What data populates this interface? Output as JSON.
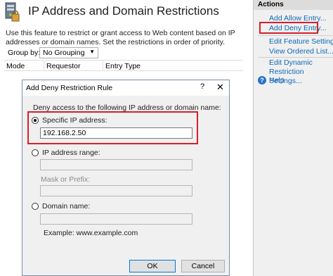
{
  "header": {
    "title": "IP Address and Domain Restrictions",
    "description": "Use this feature to restrict or grant access to Web content based on IP addresses or domain names. Set the restrictions in order of priority."
  },
  "toolbar": {
    "groupby_label": "Group by:",
    "groupby_value": "No Grouping"
  },
  "list": {
    "columns": [
      "Mode",
      "Requestor",
      "Entry Type"
    ]
  },
  "actions": {
    "title": "Actions",
    "items": [
      "Add Allow Entry...",
      "Add Deny Entry...",
      "Edit Feature Settings...",
      "View Ordered List...",
      "Edit Dynamic Restriction Settings...",
      "Help"
    ]
  },
  "dialog": {
    "title": "Add Deny Restriction Rule",
    "help_glyph": "?",
    "close_glyph": "✕",
    "prompt": "Deny access to the following IP address or domain name:",
    "specific_ip_label": "Specific IP address:",
    "specific_ip_value": "192.168.2.50",
    "ip_range_label": "IP address range:",
    "mask_label": "Mask or Prefix:",
    "domain_label": "Domain name:",
    "example": "Example: www.example.com",
    "ok_label": "OK",
    "cancel_label": "Cancel",
    "selected_option": "specific_ip"
  },
  "colors": {
    "highlight": "#d6202a",
    "link": "#0f68b5"
  },
  "icons": {
    "app": "server-icon",
    "help": "help-icon",
    "dropdown": "chevron-down-icon"
  }
}
